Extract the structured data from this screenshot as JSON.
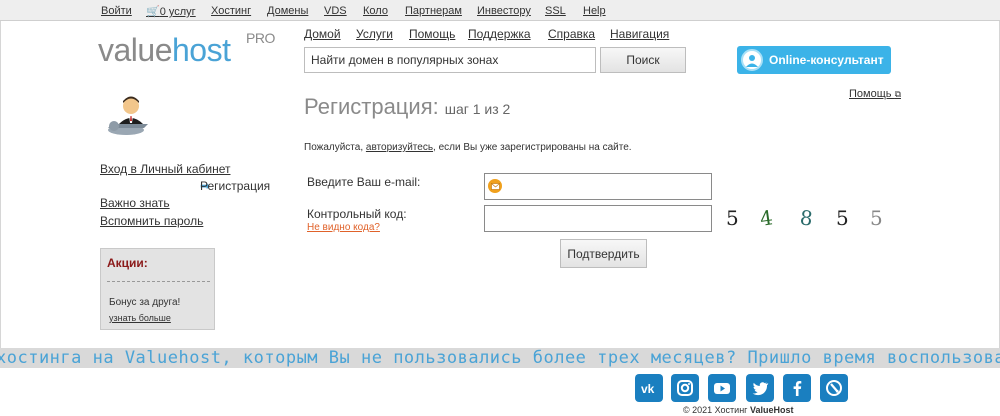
{
  "topbar": {
    "items": [
      "Войти",
      "0 услуг",
      "Хостинг",
      "Домены",
      "VDS",
      "Коло",
      "Партнерам",
      "Инвестору",
      "SSL",
      "Help"
    ]
  },
  "logo": {
    "text1": "value",
    "text2": "host",
    "sup": "PRO"
  },
  "mainnav": {
    "items": [
      "Домой",
      "Услуги",
      "Помощь",
      "Поддержка",
      "Справка",
      "Навигация"
    ]
  },
  "search": {
    "placeholder": "Найти домен в популярных зонах",
    "button": "Поиск"
  },
  "consultant": {
    "label": "Online-консультант"
  },
  "help_link": "Помощь",
  "leftnav": {
    "login": "Вход в Личный кабинет",
    "register": "Регистрация",
    "important": "Важно знать",
    "remember": "Вспомнить пароль"
  },
  "promo": {
    "title": "Акции:",
    "bonus": "Бонус за друга!",
    "more": "узнать больше"
  },
  "heading": {
    "title": "Регистрация:",
    "step": "шаг 1 из 2"
  },
  "notice": {
    "pre": "Пожалуйста, ",
    "link": "авторизуйтесь",
    "post": ", если Вы уже зарегистрированы на сайте."
  },
  "form": {
    "email_label": "Введите Ваш e-mail:",
    "code_label": "Контрольный код:",
    "no_code": "Не видно кода?",
    "submit": "Подтвердить"
  },
  "captcha": [
    "5",
    "4",
    "8",
    "5",
    "5"
  ],
  "ticker": "хостинга на Valuehost, которым Вы не пользовались более трех месяцев? Пришло время воспользоват",
  "footer": {
    "copyright_pre": "© 2021 Хостинг ",
    "copyright_brand": "ValueHost"
  },
  "colors": {
    "accent": "#4aa3d6",
    "social": "#1a7fc0",
    "promo_title": "#8b1a1a",
    "link_orange": "#e0622a"
  }
}
